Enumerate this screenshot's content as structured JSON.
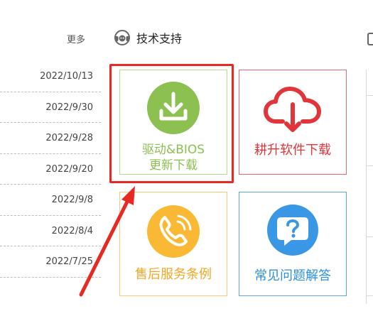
{
  "news": {
    "more_label": "更多",
    "dates": [
      "2022/10/13",
      "2022/9/30",
      "2022/9/28",
      "2022/9/20",
      "2022/9/8",
      "2022/8/4",
      "2022/7/25"
    ]
  },
  "support": {
    "title": "技术支持",
    "icon": "headset-icon",
    "tiles": {
      "driver": {
        "line1": "驱动&BIOS",
        "line2": "更新下载",
        "icon": "download-icon",
        "color": "#8cc051"
      },
      "software": {
        "label": "耕升软件下载",
        "icon": "cloud-download-icon",
        "color": "#e0363b"
      },
      "aftersales": {
        "label": "售后服务条例",
        "icon": "phone-icon",
        "color": "#f5a623"
      },
      "faq": {
        "label": "常见问题解答",
        "icon": "question-bubble-icon",
        "color": "#2b8fe3"
      }
    }
  },
  "annotation": {
    "color": "#e62a22"
  }
}
